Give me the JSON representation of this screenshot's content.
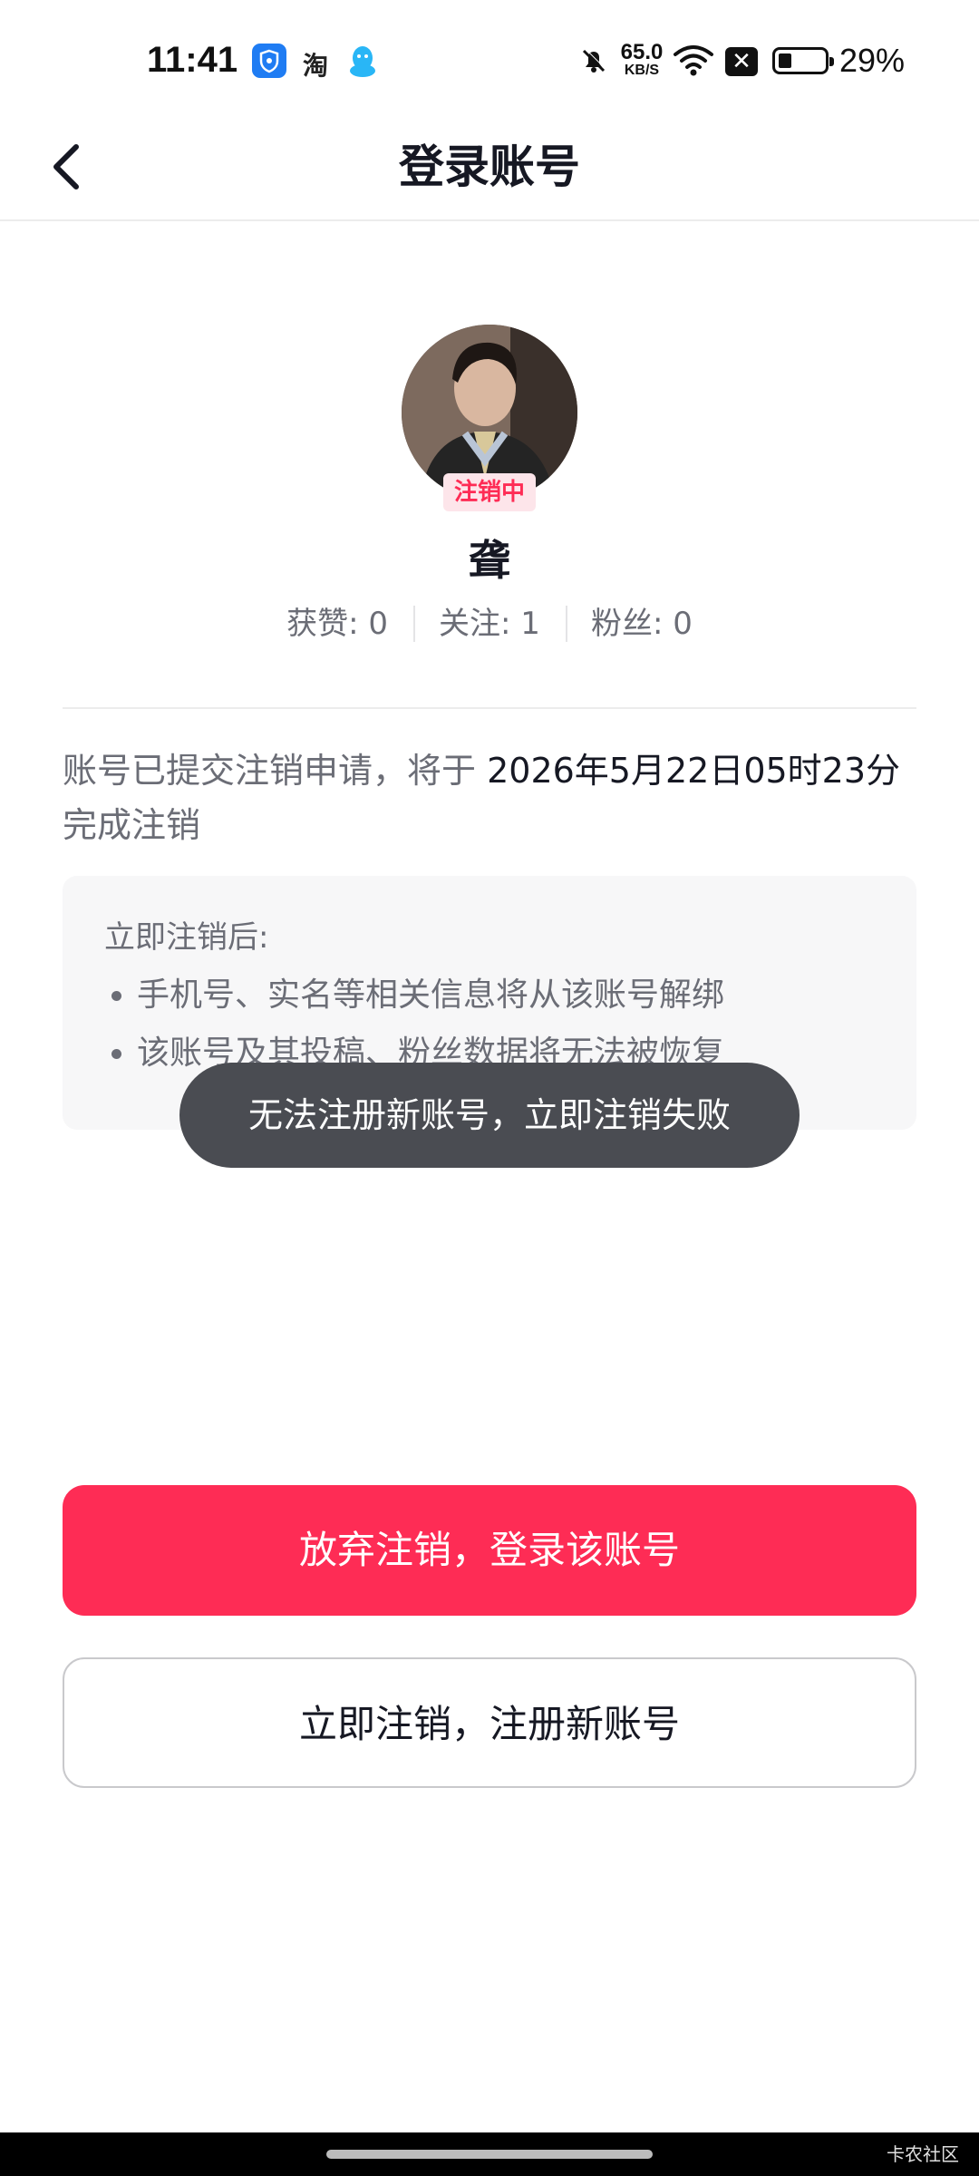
{
  "status_bar": {
    "time": "11:41",
    "app_icons": [
      "shield-icon",
      "taobao-icon",
      "qq-icon"
    ],
    "taobao_glyph": "淘",
    "net_speed_value": "65.0",
    "net_speed_unit": "KB/S",
    "close_glyph": "✕",
    "battery_level": 0.29,
    "battery_text": "29%"
  },
  "header": {
    "back_label": "",
    "title": "登录账号"
  },
  "profile": {
    "status_badge": "注销中",
    "username": "聋",
    "stats": [
      {
        "label": "获赞: 0"
      },
      {
        "label": "关注: 1"
      },
      {
        "label": "粉丝: 0"
      }
    ]
  },
  "notice": {
    "prefix": "账号已提交注销申请，将于 ",
    "date": "2026年5月22日05时23分",
    "suffix": " 完成注销"
  },
  "info_box": {
    "title": "立即注销后:",
    "items": [
      "手机号、实名等相关信息将从该账号解绑",
      "该账号及其投稿、粉丝数据将无法被恢复"
    ]
  },
  "toast": {
    "message": "无法注册新账号，立即注销失败"
  },
  "actions": {
    "primary_label": "放弃注销，登录该账号",
    "secondary_label": "立即注销，注册新账号"
  },
  "footer": {
    "watermark": "卡农社区"
  },
  "colors": {
    "accent": "#fe2c55",
    "toast_bg": "#4a4c52",
    "text_primary": "#161823",
    "text_secondary": "#6b6d76"
  }
}
